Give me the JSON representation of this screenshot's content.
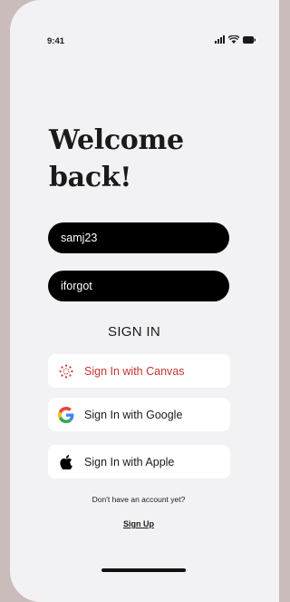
{
  "status_bar": {
    "time": "9:41",
    "icons": [
      "cellular-signal-icon",
      "wifi-icon",
      "battery-icon"
    ]
  },
  "welcome": {
    "line1": "Welcome",
    "line2": "back!"
  },
  "form": {
    "username_value": "samj23",
    "password_value": "iforgot",
    "signin_label": "SIGN IN"
  },
  "social": {
    "canvas_label": "Sign In with Canvas",
    "google_label": "Sign In with Google",
    "apple_label": "Sign In with Apple"
  },
  "footer": {
    "no_account": "Don't have an account yet?",
    "signup_label": "Sign Up"
  },
  "colors": {
    "background": "#c9bcba",
    "screen": "#f2f2f4",
    "field": "#000000",
    "canvas_red": "#c3342e"
  }
}
